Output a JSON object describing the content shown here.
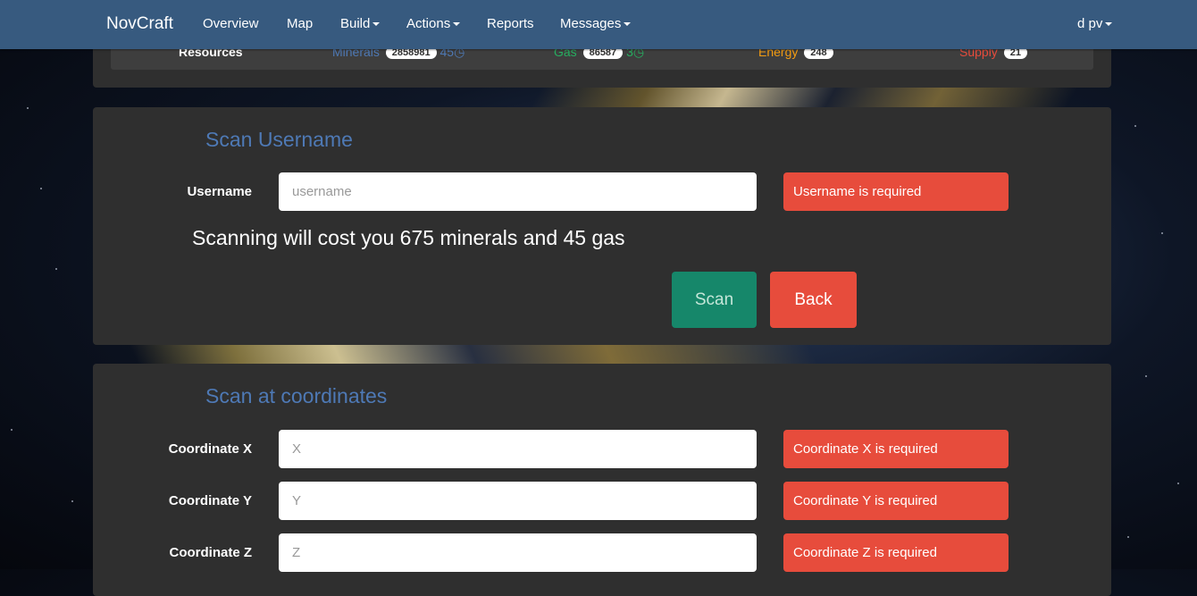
{
  "navbar": {
    "brand": "NovCraft",
    "items": [
      {
        "label": "Overview",
        "dropdown": false
      },
      {
        "label": "Map",
        "dropdown": false
      },
      {
        "label": "Build",
        "dropdown": true
      },
      {
        "label": "Actions",
        "dropdown": true
      },
      {
        "label": "Reports",
        "dropdown": false
      },
      {
        "label": "Messages",
        "dropdown": true
      }
    ],
    "user": "d pv"
  },
  "resources": {
    "label": "Resources",
    "minerals": {
      "label": "Minerals",
      "value": "2858981",
      "rate": "45",
      "color": "#4e79b5"
    },
    "gas": {
      "label": "Gas",
      "value": "86587",
      "rate": "3",
      "color": "#27ae60"
    },
    "energy": {
      "label": "Energy",
      "value": "248",
      "color": "#f39c12"
    },
    "supply": {
      "label": "Supply",
      "value": "21",
      "color": "#e74c3c"
    }
  },
  "scan_username": {
    "title": "Scan Username",
    "username_label": "Username",
    "username_placeholder": "username",
    "username_value": "",
    "username_error": "Username is required",
    "cost_text": "Scanning will cost you 675 minerals and 45 gas",
    "scan_button": "Scan",
    "back_button": "Back"
  },
  "scan_coordinates": {
    "title": "Scan at coordinates",
    "fields": [
      {
        "label": "Coordinate X",
        "placeholder": "X",
        "error": "Coordinate X is required"
      },
      {
        "label": "Coordinate Y",
        "placeholder": "Y",
        "error": "Coordinate Y is required"
      },
      {
        "label": "Coordinate Z",
        "placeholder": "Z",
        "error": "Coordinate Z is required"
      }
    ]
  },
  "colors": {
    "navbar": "#375a7f",
    "panel": "#2f2f2f",
    "title_blue": "#4e79b5",
    "danger": "#e74c3c",
    "success": "#16876a"
  }
}
